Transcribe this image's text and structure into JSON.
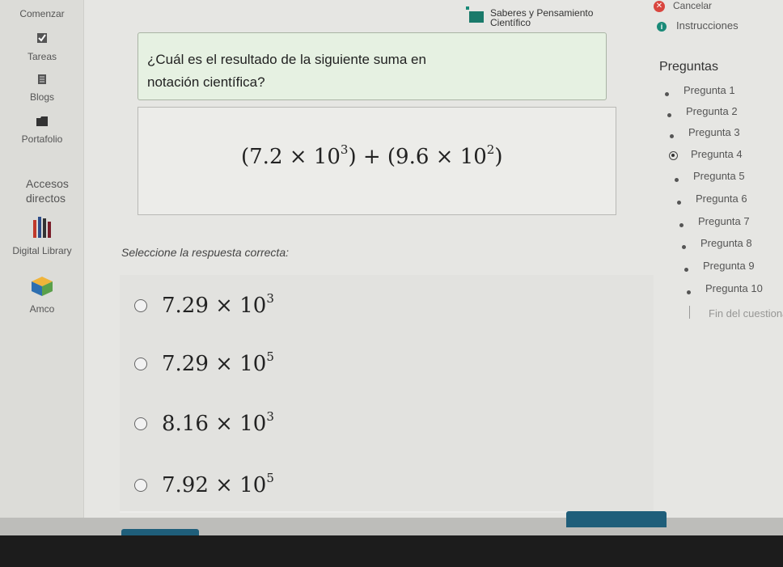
{
  "sidebar": {
    "items": [
      {
        "label": "Comenzar",
        "icon": "start-icon"
      },
      {
        "label": "Tareas",
        "icon": "checkbox-icon"
      },
      {
        "label": "Blogs",
        "icon": "notebook-icon"
      },
      {
        "label": "Portafolio",
        "icon": "folder-icon"
      },
      {
        "label": "Accesos directos",
        "icon": "shortcut-icon"
      },
      {
        "label": "Digital Library",
        "icon": "books-icon"
      },
      {
        "label": "Amco",
        "icon": "cube-icon"
      }
    ]
  },
  "header": {
    "title": "Saberes y Pensamiento Científico",
    "cancel_label": "Cancelar",
    "instructions_label": "Instrucciones"
  },
  "question": {
    "text": "¿Cuál es el resultado de la siguiente suma en notación científica?",
    "expression": "(7.2 × 10^3) + (9.6 × 10^2)",
    "prompt": "Seleccione la respuesta correcta:",
    "options": [
      {
        "mantissa": "7.29 ×",
        "exp_base": "10",
        "exp": "3"
      },
      {
        "mantissa": "7.29 ×",
        "exp_base": "10",
        "exp": "5"
      },
      {
        "mantissa": "8.16 ×",
        "exp_base": "10",
        "exp": "3"
      },
      {
        "mantissa": "7.92 ×",
        "exp_base": "10",
        "exp": "5"
      }
    ]
  },
  "nav": {
    "title": "Preguntas",
    "items": [
      "Pregunta 1",
      "Pregunta 2",
      "Pregunta 3",
      "Pregunta 4",
      "Pregunta 5",
      "Pregunta 6",
      "Pregunta 7",
      "Pregunta 8",
      "Pregunta 9",
      "Pregunta 10"
    ],
    "current_index": 3,
    "end_label": "Fin del cuestionario"
  },
  "colors": {
    "accent": "#1f5e7a",
    "question_bg": "#e6f1e2",
    "cancel": "#d9463f",
    "info": "#1a8a78"
  }
}
